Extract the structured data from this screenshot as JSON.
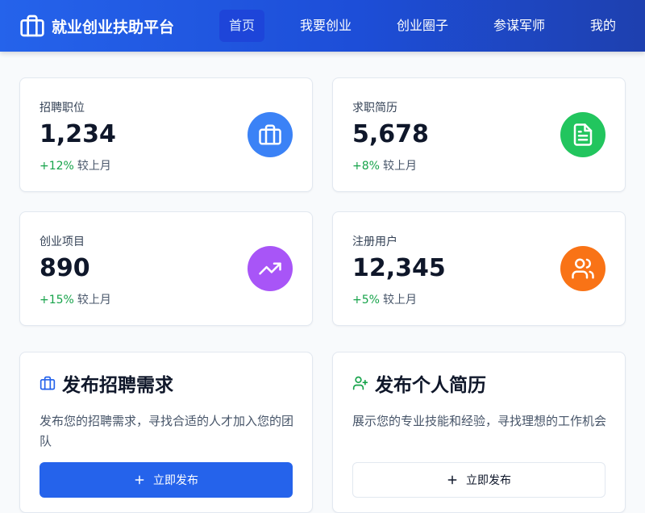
{
  "header": {
    "brand_title": "就业创业扶助平台",
    "brand_icon": "briefcase-icon",
    "nav": [
      {
        "label": "首页",
        "active": true
      },
      {
        "label": "我要创业",
        "active": false
      },
      {
        "label": "创业圈子",
        "active": false
      },
      {
        "label": "参谋军师",
        "active": false
      },
      {
        "label": "我的",
        "active": false
      }
    ]
  },
  "stats": [
    {
      "label": "招聘职位",
      "value": "1,234",
      "change": "+12%",
      "change_suffix": "较上月",
      "icon": "briefcase-icon",
      "color": "#3b82f6"
    },
    {
      "label": "求职简历",
      "value": "5,678",
      "change": "+8%",
      "change_suffix": "较上月",
      "icon": "document-icon",
      "color": "#22c55e"
    },
    {
      "label": "创业项目",
      "value": "890",
      "change": "+15%",
      "change_suffix": "较上月",
      "icon": "trending-up-icon",
      "color": "#a855f7"
    },
    {
      "label": "注册用户",
      "value": "12,345",
      "change": "+5%",
      "change_suffix": "较上月",
      "icon": "users-icon",
      "color": "#f97316"
    }
  ],
  "actions": [
    {
      "title": "发布招聘需求",
      "icon": "briefcase-icon",
      "description": "发布您的招聘需求，寻找合适的人才加入您的团队",
      "button_label": "立即发布",
      "button_icon": "plus-icon"
    },
    {
      "title": "发布个人简历",
      "icon": "user-plus-icon",
      "description": "展示您的专业技能和经验，寻找理想的工作机会",
      "button_label": "立即发布",
      "button_icon": "plus-icon"
    }
  ],
  "colors": {
    "header_start": "#2563eb",
    "header_end": "#1e40af",
    "positive": "#16a34a",
    "primary_button": "#2563eb"
  }
}
